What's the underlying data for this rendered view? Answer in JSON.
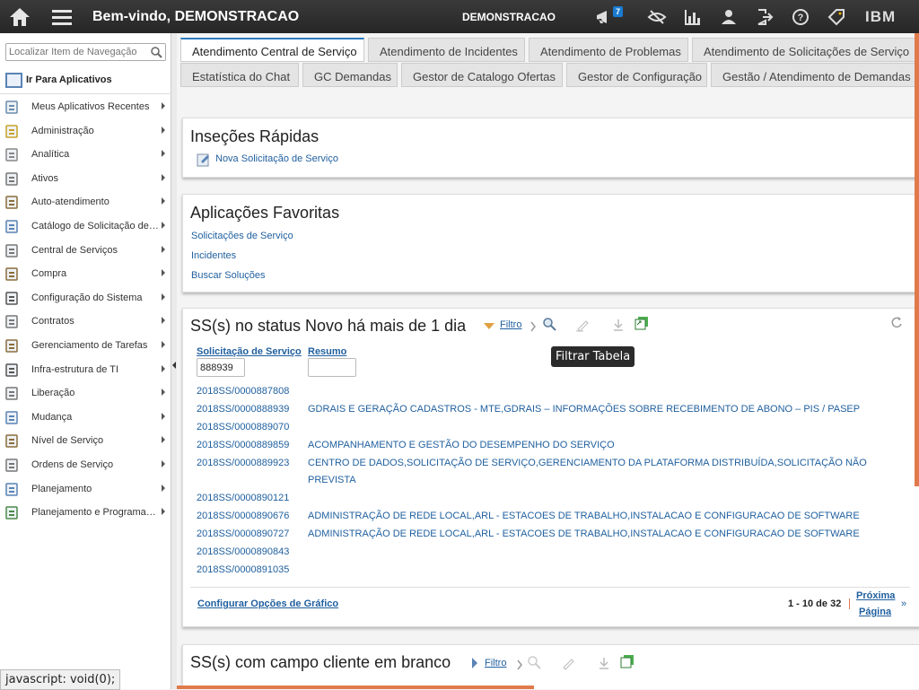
{
  "topbar": {
    "welcome": "Bem-vindo, DEMONSTRACAO",
    "user": "DEMONSTRACAO",
    "badge_count": "7",
    "brand": "IBM",
    "icons": [
      "home-icon",
      "menu-icon",
      "megaphone-icon",
      "eye-off-icon",
      "bar-chart-icon",
      "user-icon",
      "logout-icon",
      "help-icon",
      "tag-icon"
    ]
  },
  "sidebar": {
    "search_placeholder": "Localizar Item de Navegação",
    "go_apps": "Ir Para Aplicativos",
    "items": [
      {
        "label": "Meus Aplicativos Recentes",
        "icon": "clock-icon"
      },
      {
        "label": "Administração",
        "icon": "keys-icon"
      },
      {
        "label": "Analítica",
        "icon": "analytics-icon"
      },
      {
        "label": "Ativos",
        "icon": "assets-icon"
      },
      {
        "label": "Auto-atendimento",
        "icon": "cart-icon"
      },
      {
        "label": "Catálogo de Solicitação de ...",
        "icon": "catalog-icon"
      },
      {
        "label": "Central de Serviços",
        "icon": "bell-icon"
      },
      {
        "label": "Compra",
        "icon": "purchase-icon"
      },
      {
        "label": "Configuração do Sistema",
        "icon": "sliders-icon"
      },
      {
        "label": "Contratos",
        "icon": "contract-icon"
      },
      {
        "label": "Gerenciamento de Tarefas",
        "icon": "briefcase-icon"
      },
      {
        "label": "Infra-estrutura de TI",
        "icon": "server-icon"
      },
      {
        "label": "Liberação",
        "icon": "release-icon"
      },
      {
        "label": "Mudança",
        "icon": "change-icon"
      },
      {
        "label": "Nível de Serviço",
        "icon": "service-level-icon"
      },
      {
        "label": "Ordens de Serviço",
        "icon": "work-order-icon"
      },
      {
        "label": "Planejamento",
        "icon": "planning-icon"
      },
      {
        "label": "Planejamento e Programação",
        "icon": "schedule-icon"
      }
    ]
  },
  "status_text": "javascript: void(0);",
  "tabs_row1": [
    "Atendimento Central de Serviço",
    "Atendimento de Incidentes",
    "Atendimento de Problemas",
    "Atendimento de Solicitações de Serviço"
  ],
  "tabs_row2": [
    "Estatística do Chat",
    "GC Demandas",
    "Gestor de Catalogo Ofertas",
    "Gestor de Configuração",
    "Gestão / Atendimento de Demandas"
  ],
  "quick": {
    "title": "Inseções Rápidas",
    "link": "Nova Solicitação de Serviço"
  },
  "favorites": {
    "title": "Aplicações Favoritas",
    "links": [
      "Solicitações de Serviço",
      "Incidentes",
      "Buscar Soluções"
    ]
  },
  "ss_table": {
    "title": "SS(s) no status Novo há mais de 1 dia",
    "filter": "Filtro",
    "col_id": "Solicitação de Serviço",
    "col_summary": "Resumo",
    "filter_id_value": "888939",
    "filter_summary_value": "",
    "tooltip": "Filtrar Tabela",
    "rows": [
      {
        "id": "2018SS/0000887808",
        "summary": ""
      },
      {
        "id": "2018SS/0000888939",
        "summary": "GDRAIS E GERAÇÃO CADASTROS - MTE,GDRAIS – INFORMAÇÕES SOBRE RECEBIMENTO DE ABONO – PIS / PASEP"
      },
      {
        "id": "2018SS/0000889070",
        "summary": ""
      },
      {
        "id": "2018SS/0000889859",
        "summary": "ACOMPANHAMENTO E GESTÃO DO DESEMPENHO DO SERVIÇO"
      },
      {
        "id": "2018SS/0000889923",
        "summary": "CENTRO DE DADOS,SOLICITAÇÃO DE SERVIÇO,GERENCIAMENTO DA PLATAFORMA DISTRIBUÍDA,SOLICITAÇÃO NÃO PREVISTA"
      },
      {
        "id": "2018SS/0000890121",
        "summary": ""
      },
      {
        "id": "2018SS/0000890676",
        "summary": "ADMINISTRAÇÃO DE REDE LOCAL,ARL - ESTACOES DE TRABALHO,INSTALACAO E CONFIGURACAO DE SOFTWARE"
      },
      {
        "id": "2018SS/0000890727",
        "summary": "ADMINISTRAÇÃO DE REDE LOCAL,ARL - ESTACOES DE TRABALHO,INSTALACAO E CONFIGURACAO DE SOFTWARE"
      },
      {
        "id": "2018SS/0000890843",
        "summary": ""
      },
      {
        "id": "2018SS/0000891035",
        "summary": ""
      }
    ],
    "config_link": "Configurar Opções de Gráfico",
    "page_info": "1 - 10 de 32",
    "next_line1": "Próxima",
    "next_line2": "Página",
    "next_arrows": "»"
  },
  "blank_client": {
    "title": "SS(s) com campo cliente em branco",
    "filter": "Filtro"
  },
  "colors": {
    "accent": "#2d7cc1",
    "link": "#1f5f9e",
    "scroll": "#e07a4b",
    "badge": "#1a7bd1"
  }
}
